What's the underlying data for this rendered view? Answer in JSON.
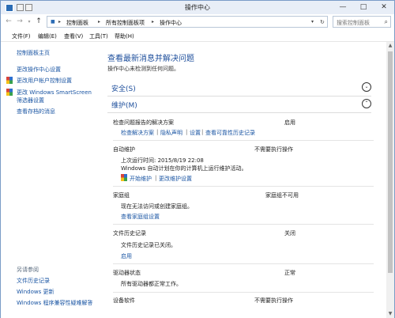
{
  "titlebar": {
    "title": "操作中心",
    "minimize": "—",
    "maximize": "□",
    "close": "✕"
  },
  "address": {
    "crumbs": [
      "控制面板",
      "所有控制面板项",
      "操作中心"
    ],
    "back_icon": "←",
    "forward_icon": "→",
    "up_icon": "↑",
    "search_placeholder": "搜索控制面板"
  },
  "menu": [
    "文件(F)",
    "编辑(E)",
    "查看(V)",
    "工具(T)",
    "帮助(H)"
  ],
  "sidebar": {
    "home": "控制面板主页",
    "links": [
      "更改操作中心设置",
      "更改用户帐户控制设置",
      "更改 Windows SmartScreen",
      "筛选器设置",
      "查看存档的消息"
    ],
    "see_also_heading": "另请参阅",
    "see_also": [
      "文件历史记录",
      "Windows 更新",
      "Windows 程序兼容性疑难解答"
    ]
  },
  "main": {
    "heading": "查看最新消息并解决问题",
    "subheading": "操作中心未检测到任何问题。",
    "security": {
      "title": "安全(S)",
      "chevron": "⌄"
    },
    "maintenance": {
      "title": "维护(M)",
      "chevron": "⌃"
    },
    "items": [
      {
        "title": "检查问题报告的解决方案",
        "status": "启用",
        "links": [
          "检查解决方案",
          "隐私声明",
          "设置",
          "查看可靠性历史记录"
        ]
      },
      {
        "title": "自动维护",
        "status": "不需要执行操作",
        "lines": [
          "上次运行时间: 2015/8/19 22:08",
          "Windows 自动计划在你的计算机上运行维护活动。"
        ],
        "links": [
          "开始维护",
          "更改维护设置"
        ]
      },
      {
        "title": "家庭组",
        "status": "家庭组不可用",
        "lines": [
          "现在无法访问或创建家庭组。"
        ],
        "links": [
          "查看家庭组设置"
        ]
      },
      {
        "title": "文件历史记录",
        "status": "关闭",
        "lines": [
          "文件历史记录已关闭。"
        ],
        "links": [
          "启用"
        ]
      },
      {
        "title": "驱动器状态",
        "status": "正常",
        "lines": [
          "所有驱动器都正常工作。"
        ]
      },
      {
        "title": "设备软件",
        "status": "不需要执行操作"
      }
    ]
  },
  "colors": {
    "link": "#1a55a3",
    "heading": "#1e4f9c"
  }
}
